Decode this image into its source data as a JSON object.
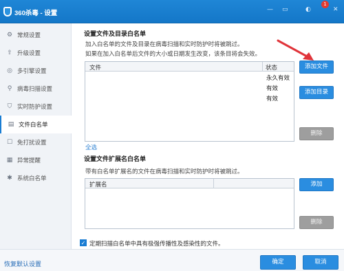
{
  "window": {
    "title": "360杀毒 - 设置",
    "badge": "1"
  },
  "sidebar": {
    "items": [
      {
        "label": "常规设置",
        "icon": "gear-icon"
      },
      {
        "label": "升级设置",
        "icon": "upload-icon"
      },
      {
        "label": "多引擎设置",
        "icon": "engine-icon"
      },
      {
        "label": "病毒扫描设置",
        "icon": "search-icon"
      },
      {
        "label": "实时防护设置",
        "icon": "shield-icon"
      },
      {
        "label": "文件白名单",
        "icon": "document-icon",
        "active": true
      },
      {
        "label": "免打扰设置",
        "icon": "quiet-icon"
      },
      {
        "label": "异常提醒",
        "icon": "alert-icon"
      },
      {
        "label": "系统白名单",
        "icon": "tools-icon"
      }
    ]
  },
  "file_whitelist": {
    "title": "设置文件及目录白名单",
    "desc1": "加入白名单的文件及目录在病毒扫描和实时防护时将被跳过。",
    "desc2": "如果在加入白名单后文件的大小或日期发生改变，该条目将会失效。",
    "columns": [
      "文件",
      "状态"
    ],
    "status_values": [
      "永久有效",
      "有效",
      "有效"
    ],
    "add_file": "添加文件",
    "add_dir": "添加目录",
    "delete": "删除",
    "select_all": "全选"
  },
  "ext_whitelist": {
    "title": "设置文件扩展名白名单",
    "desc": "带有白名单扩展名的文件在病毒扫描和实时防护时将被跳过。",
    "columns": [
      "扩展名"
    ],
    "add": "添加",
    "delete": "删除"
  },
  "footer": {
    "checkbox_label": "定期扫描白名单中具有极强传播性及感染性的文件。",
    "restore_defaults": "恢复默认设置",
    "ok": "确定",
    "cancel": "取消"
  },
  "colors": {
    "titlebar": "#1477c8",
    "accent": "#2a8de0",
    "arrow": "#e0343a"
  }
}
